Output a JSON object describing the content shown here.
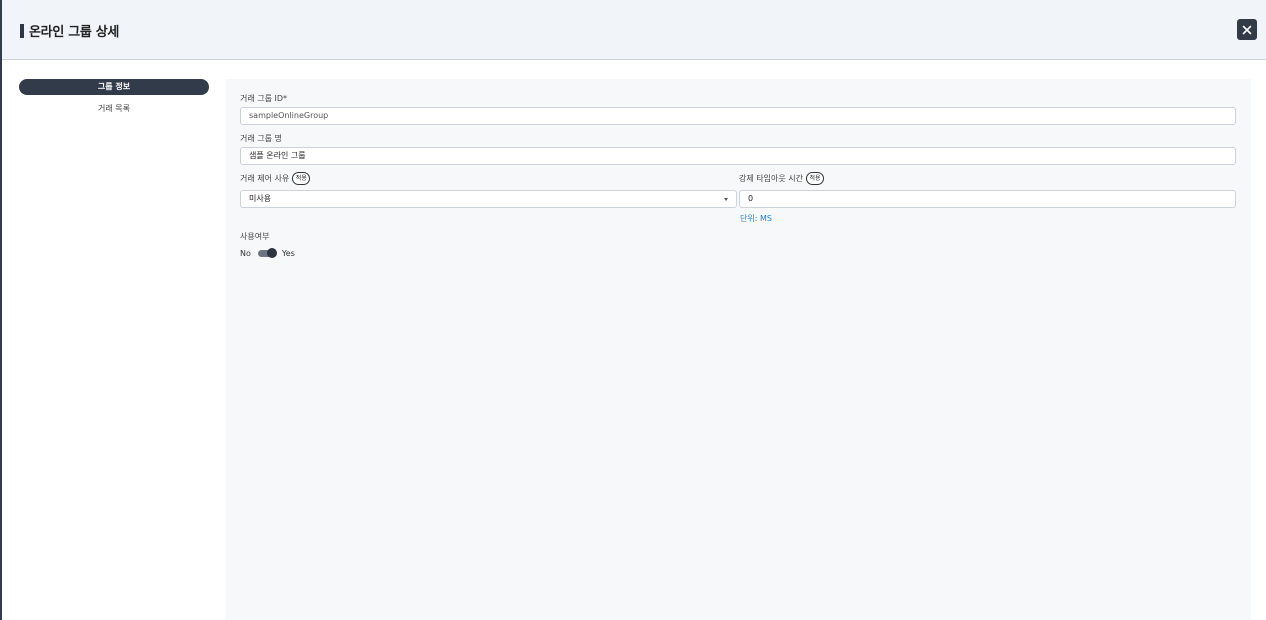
{
  "header": {
    "title": "온라인 그룹 상세",
    "close_icon": "close-icon"
  },
  "sidebar": {
    "items": [
      {
        "label": "그룹 정보",
        "active": true
      },
      {
        "label": "거래 목록",
        "active": false
      }
    ]
  },
  "form": {
    "group_id": {
      "label": "거래 그룹 ID*",
      "value": "sampleOnlineGroup"
    },
    "group_name": {
      "label": "거래 그룹 명",
      "value": "샘플 온라인 그룹"
    },
    "control_reason": {
      "label": "거래 제어 사유",
      "apply_label": "적용",
      "selected": "미사용"
    },
    "forced_timeout": {
      "label": "강제 타임아웃 시간",
      "apply_label": "적용",
      "value": "0",
      "unit_hint": "단위: MS"
    },
    "use_flag": {
      "label": "사용여부",
      "off_label": "No",
      "on_label": "Yes",
      "enabled": true
    }
  },
  "colors": {
    "accent_dark": "#323b49",
    "hint_blue": "#1e7fd8",
    "header_bg": "#f1f4f8",
    "panel_bg": "#f6f8fa"
  }
}
